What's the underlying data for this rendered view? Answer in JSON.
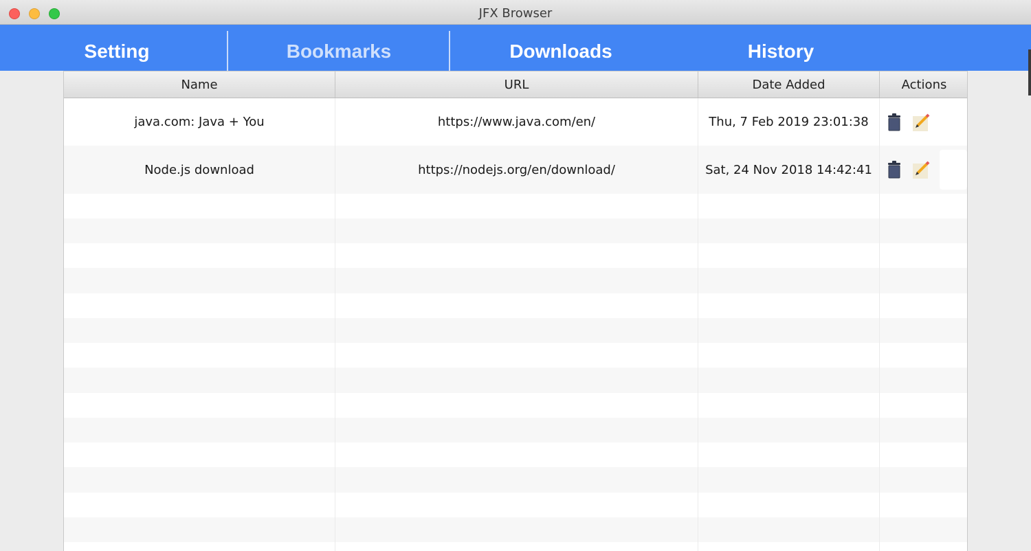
{
  "window": {
    "title": "JFX Browser"
  },
  "tabs": [
    {
      "id": "setting",
      "label": "Setting"
    },
    {
      "id": "bookmarks",
      "label": "Bookmarks",
      "selected": true
    },
    {
      "id": "downloads",
      "label": "Downloads"
    },
    {
      "id": "history",
      "label": "History"
    }
  ],
  "table": {
    "headers": {
      "name": "Name",
      "url": "URL",
      "date": "Date Added",
      "actions": "Actions"
    },
    "rows": [
      {
        "name": "java.com: Java + You",
        "url": "https://www.java.com/en/",
        "date": "Thu, 7 Feb 2019 23:01:38",
        "actions": [
          "trash-icon",
          "edit-icon"
        ]
      },
      {
        "name": "Node.js download",
        "url": "https://nodejs.org/en/download/",
        "date": "Sat, 24 Nov 2018 14:42:41",
        "actions": [
          "trash-icon",
          "edit-icon"
        ]
      }
    ]
  },
  "colors": {
    "tab_bar": "#4285f4",
    "tab_text": "#ffffff",
    "tab_text_selected": "#cfe0fc",
    "row_alt": "#f7f7f7"
  }
}
